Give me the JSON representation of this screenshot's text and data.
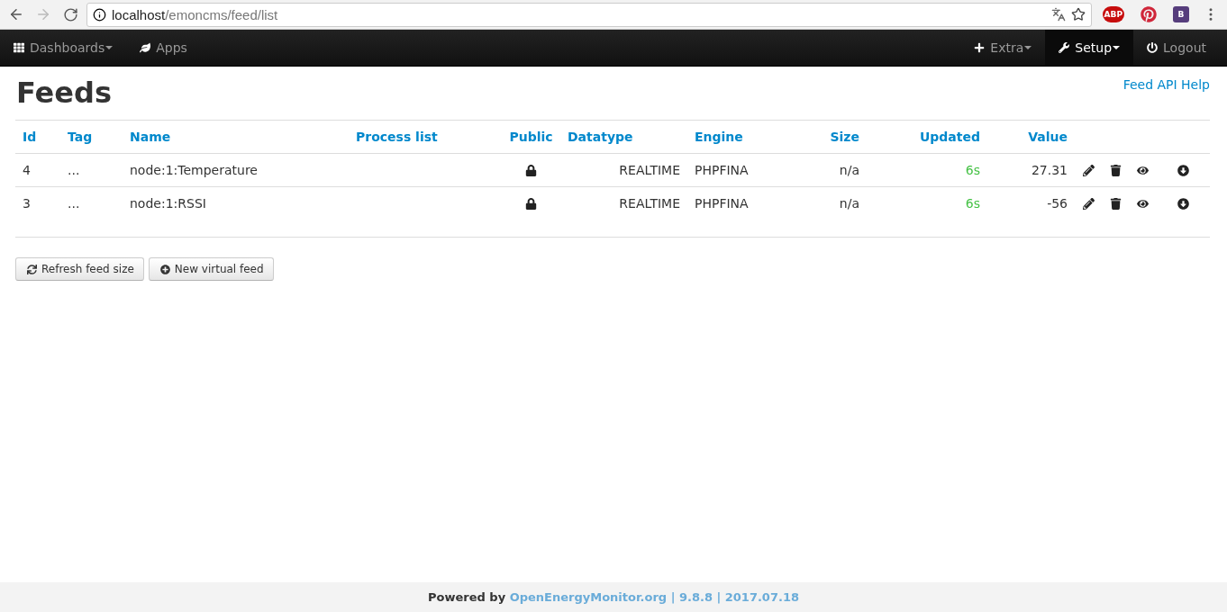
{
  "browser": {
    "url_host": "localhost",
    "url_path": "/emoncms/feed/list",
    "extensions": [
      {
        "kind": "abp",
        "label": "ABP"
      },
      {
        "kind": "pinterest"
      },
      {
        "kind": "bootstrap",
        "label": "B"
      }
    ]
  },
  "nav": {
    "left": [
      {
        "kind": "grid",
        "label": "Dashboards",
        "dropdown": true,
        "selected": false
      },
      {
        "kind": "leaf",
        "label": "Apps",
        "dropdown": false,
        "selected": false
      }
    ],
    "right": [
      {
        "kind": "plus",
        "label": "Extra",
        "dropdown": true,
        "selected": false
      },
      {
        "kind": "wrench",
        "label": "Setup",
        "dropdown": true,
        "selected": true
      },
      {
        "kind": "power",
        "label": "Logout",
        "dropdown": false,
        "selected": false
      }
    ]
  },
  "page": {
    "title": "Feeds",
    "help_link": "Feed API Help"
  },
  "table": {
    "columns": [
      "Id",
      "Tag",
      "Name",
      "Process list",
      "Public",
      "Datatype",
      "Engine",
      "Size",
      "Updated",
      "Value"
    ],
    "rows": [
      {
        "id": "4",
        "tag": "...",
        "name": "node:1:Temperature",
        "process_list": "",
        "public": false,
        "datatype": "REALTIME",
        "engine": "PHPFINA",
        "size": "n/a",
        "updated": "6s",
        "value": "27.31"
      },
      {
        "id": "3",
        "tag": "...",
        "name": "node:1:RSSI",
        "process_list": "",
        "public": false,
        "datatype": "REALTIME",
        "engine": "PHPFINA",
        "size": "n/a",
        "updated": "6s",
        "value": "-56"
      }
    ]
  },
  "buttons": [
    {
      "kind": "refresh",
      "label": "Refresh feed size"
    },
    {
      "kind": "add",
      "label": "New virtual feed"
    }
  ],
  "footer": {
    "prefix": "Powered by",
    "link": "OpenEnergyMonitor.org",
    "suffix": "| 9.8.8 | 2017.07.18"
  }
}
